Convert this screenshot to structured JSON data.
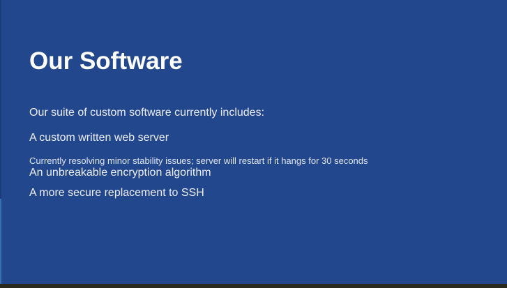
{
  "slide": {
    "title": "Our Software",
    "intro": "Our suite of custom software currently includes:",
    "items": [
      {
        "label": "A custom written web server"
      },
      {
        "label": "An unbreakable encryption algorithm"
      },
      {
        "label": "A more secure replacement to SSH"
      }
    ],
    "note": "Currently resolving minor stability issues; server will restart if it hangs for 30 seconds"
  },
  "colors": {
    "background": "#23478c",
    "text": "#ffffff",
    "bottom_bar": "#2a2a1e"
  }
}
